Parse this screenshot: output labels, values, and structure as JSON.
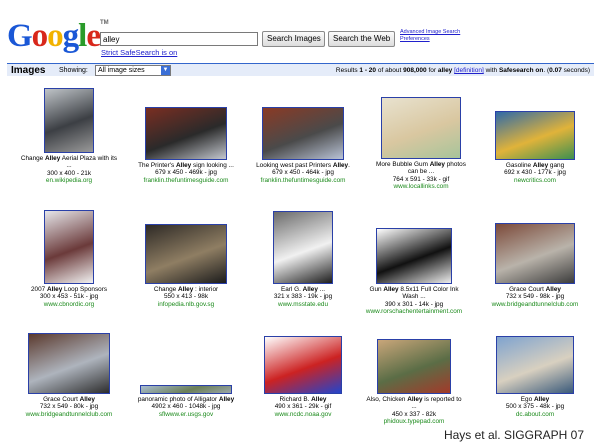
{
  "header": {
    "logo_text": "Google",
    "logo_tm": "TM",
    "search_value": "alley",
    "search_images_label": "Search Images",
    "search_web_label": "Search the Web",
    "advanced_search_label": "Advanced Image Search",
    "preferences_label": "Preferences",
    "safesearch_label": "Strict SafeSearch is on"
  },
  "bar": {
    "title": "Images",
    "showing_label": "Showing:",
    "size_select_value": "All image sizes",
    "results_prefix": "Results ",
    "results_range": "1 - 20",
    "results_mid": " of about ",
    "results_count": "908,000",
    "results_for": " for ",
    "query": "alley",
    "definition_label": "[definition]",
    "results_with": " with ",
    "safesearch_on": "Safesearch on",
    "results_time_prefix": ". (",
    "results_time": "0.07",
    "results_time_suffix": " seconds)"
  },
  "results": [
    {
      "caption_pre": "Change ",
      "caption_bold": "Alley",
      "caption_post": " Aerial Plaza with its",
      "caption2": "...",
      "meta": "300 x 400 - 21k",
      "site": "en.wikipedia.org",
      "colors": [
        "#bfc4c8",
        "#3c3f44",
        "#9a9a9a"
      ]
    },
    {
      "caption_pre": "The Printer's ",
      "caption_bold": "Alley",
      "caption_post": " sign looking ...",
      "caption2": "",
      "meta": "679 x 450 - 469k - jpg",
      "site": "franklin.thefuntimesguide.com",
      "colors": [
        "#7a2e22",
        "#2a2a2a",
        "#c4c8cf"
      ]
    },
    {
      "caption_pre": "Looking west past Printers ",
      "caption_bold": "Alley",
      "caption_post": ".",
      "caption2": "",
      "meta": "679 x 450 - 464k - jpg",
      "site": "franklin.thefuntimesguide.com",
      "colors": [
        "#8a3a25",
        "#4a4a4a",
        "#b9c3d6"
      ]
    },
    {
      "caption_pre": "More Bubble Gum ",
      "caption_bold": "Alley",
      "caption_post": " photos",
      "caption2": "can be ...",
      "meta": "764 x 591 - 33k - gif",
      "site": "www.locallinks.com",
      "colors": [
        "#e8e2cf",
        "#d9c7a0",
        "#a7c49a"
      ]
    },
    {
      "caption_pre": "Gasoline ",
      "caption_bold": "Alley",
      "caption_post": " gang",
      "caption2": "",
      "meta": "692 x 430 - 177k - jpg",
      "site": "newcritics.com",
      "colors": [
        "#2f6aa8",
        "#e0b33a",
        "#3d8f4f"
      ]
    },
    {
      "caption_pre": "2007 ",
      "caption_bold": "Alley",
      "caption_post": " Loop Sponsors",
      "caption2": "",
      "meta": "300 x 453 - 51k - jpg",
      "site": "www.cbnordic.org",
      "colors": [
        "#e6e6ea",
        "#6b3a3a",
        "#f2f2f2"
      ]
    },
    {
      "caption_pre": "Change ",
      "caption_bold": "Alley",
      "caption_post": " : interior",
      "caption2": "",
      "meta": "550 x 413 - 98k",
      "site": "infopedia.nlb.gov.sg",
      "colors": [
        "#2e2a26",
        "#8f7e63",
        "#1c1c1c"
      ]
    },
    {
      "caption_pre": "Earl G. ",
      "caption_bold": "Alley",
      "caption_post": " ...",
      "caption2": "",
      "meta": "321 x 383 - 19k - jpg",
      "site": "www.msstate.edu",
      "colors": [
        "#6b6b6b",
        "#f1f1f1",
        "#1d1d1d"
      ]
    },
    {
      "caption_pre": "Gun ",
      "caption_bold": "Alley",
      "caption_post": " 8.5x11 Full Color Ink",
      "caption2": "Wash ...",
      "meta": "390 x 301 - 14k - jpg",
      "site": "www.rorschachentertainment.com",
      "colors": [
        "#ffffff",
        "#111111",
        "#eeeeee"
      ]
    },
    {
      "caption_pre": "Grace Court ",
      "caption_bold": "Alley",
      "caption_post": "",
      "caption2": "",
      "meta": "732 x 549 - 98k - jpg",
      "site": "www.bridgeandtunnelclub.com",
      "colors": [
        "#7c4a3a",
        "#b9b3aa",
        "#3c3c3c"
      ]
    },
    {
      "caption_pre": "Grace Court ",
      "caption_bold": "Alley",
      "caption_post": "",
      "caption2": "",
      "meta": "732 x 549 - 80k - jpg",
      "site": "www.bridgeandtunnelclub.com",
      "colors": [
        "#5b3a2e",
        "#aeb4bd",
        "#2d2d2d"
      ]
    },
    {
      "caption_pre": "panoramic photo of Alligator ",
      "caption_bold": "Alley",
      "caption_post": "",
      "caption2": "",
      "meta": "4902 x 460 - 1048k - jpg",
      "site": "sflwww.er.usgs.gov",
      "colors": [
        "#a9bdd1",
        "#6b7f58",
        "#9aa6a8"
      ]
    },
    {
      "caption_pre": "Richard B. ",
      "caption_bold": "Alley",
      "caption_post": "",
      "caption2": "",
      "meta": "490 x 361 - 29k - gif",
      "site": "www.ncdc.noaa.gov",
      "colors": [
        "#ffffff",
        "#cc2222",
        "#2244cc"
      ]
    },
    {
      "caption_pre": "Also, Chicken ",
      "caption_bold": "Alley",
      "caption_post": " is reported to",
      "caption2": "...",
      "meta": "450 x 337 - 82k",
      "site": "phidoux.typepad.com",
      "colors": [
        "#c9a67a",
        "#5b6d46",
        "#a33a2a"
      ]
    },
    {
      "caption_pre": "Ego ",
      "caption_bold": "Alley",
      "caption_post": "",
      "caption2": "",
      "meta": "500 x 375 - 48k - jpg",
      "site": "dc.about.com",
      "colors": [
        "#7fa3cf",
        "#d8d0c0",
        "#3a5a7a"
      ]
    }
  ],
  "credit": "Hays et al. SIGGRAPH 07"
}
